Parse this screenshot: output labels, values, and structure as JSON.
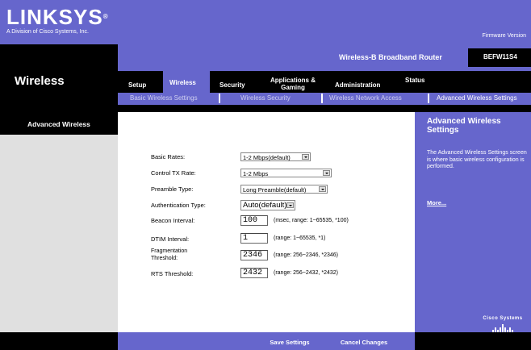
{
  "header": {
    "logo": "LINKSYS",
    "logo_mark": "®",
    "logo_sub": "A Division of Cisco Systems, Inc.",
    "firmware": "Firmware Version"
  },
  "product": {
    "name": "Wireless-B Broadband Router",
    "model": "BEFW11S4"
  },
  "section_title": "Wireless",
  "tabs": [
    {
      "label": "Setup"
    },
    {
      "label": "Wireless"
    },
    {
      "label": "Security"
    },
    {
      "label": "Applications &\nGaming"
    },
    {
      "label": "Administration"
    },
    {
      "label": "Status"
    }
  ],
  "subtabs": [
    {
      "label": "Basic Wireless Settings"
    },
    {
      "label": "Wireless Security"
    },
    {
      "label": "Wireless Network Access"
    },
    {
      "label": "Advanced Wireless Settings"
    }
  ],
  "left_title": "Advanced Wireless",
  "form": {
    "basic_rates": {
      "label": "Basic Rates:",
      "value": "1-2 Mbps(default)"
    },
    "control_tx_rate": {
      "label": "Control TX Rate:",
      "value": "1-2 Mbps"
    },
    "preamble_type": {
      "label": "Preamble Type:",
      "value": "Long Preamble(default)"
    },
    "authentication_type": {
      "label": "Authentication Type:",
      "value": "Auto(default)"
    },
    "beacon_interval": {
      "label": "Beacon Interval:",
      "value": "100",
      "hint": "(msec, range: 1~65535, *100)"
    },
    "dtim_interval": {
      "label": "DTIM Interval:",
      "value": "1",
      "hint": "(range: 1~65535, *1)"
    },
    "fragmentation_threshold": {
      "label": "Fragmentation\nThreshold:",
      "value": "2346",
      "hint": "(range: 256~2346, *2346)"
    },
    "rts_threshold": {
      "label": "RTS Threshold:",
      "value": "2432",
      "hint": "(range: 256~2432, *2432)"
    }
  },
  "help": {
    "title": "Advanced Wireless Settings",
    "text": "The Advanced Wireless Settings screen is where basic wireless configuration is performed.",
    "more": "More..."
  },
  "cisco": "Cisco Systems",
  "buttons": {
    "save": "Save Settings",
    "cancel": "Cancel Changes"
  },
  "colors": {
    "brand_purple": "#6666cc",
    "black": "#000000"
  }
}
